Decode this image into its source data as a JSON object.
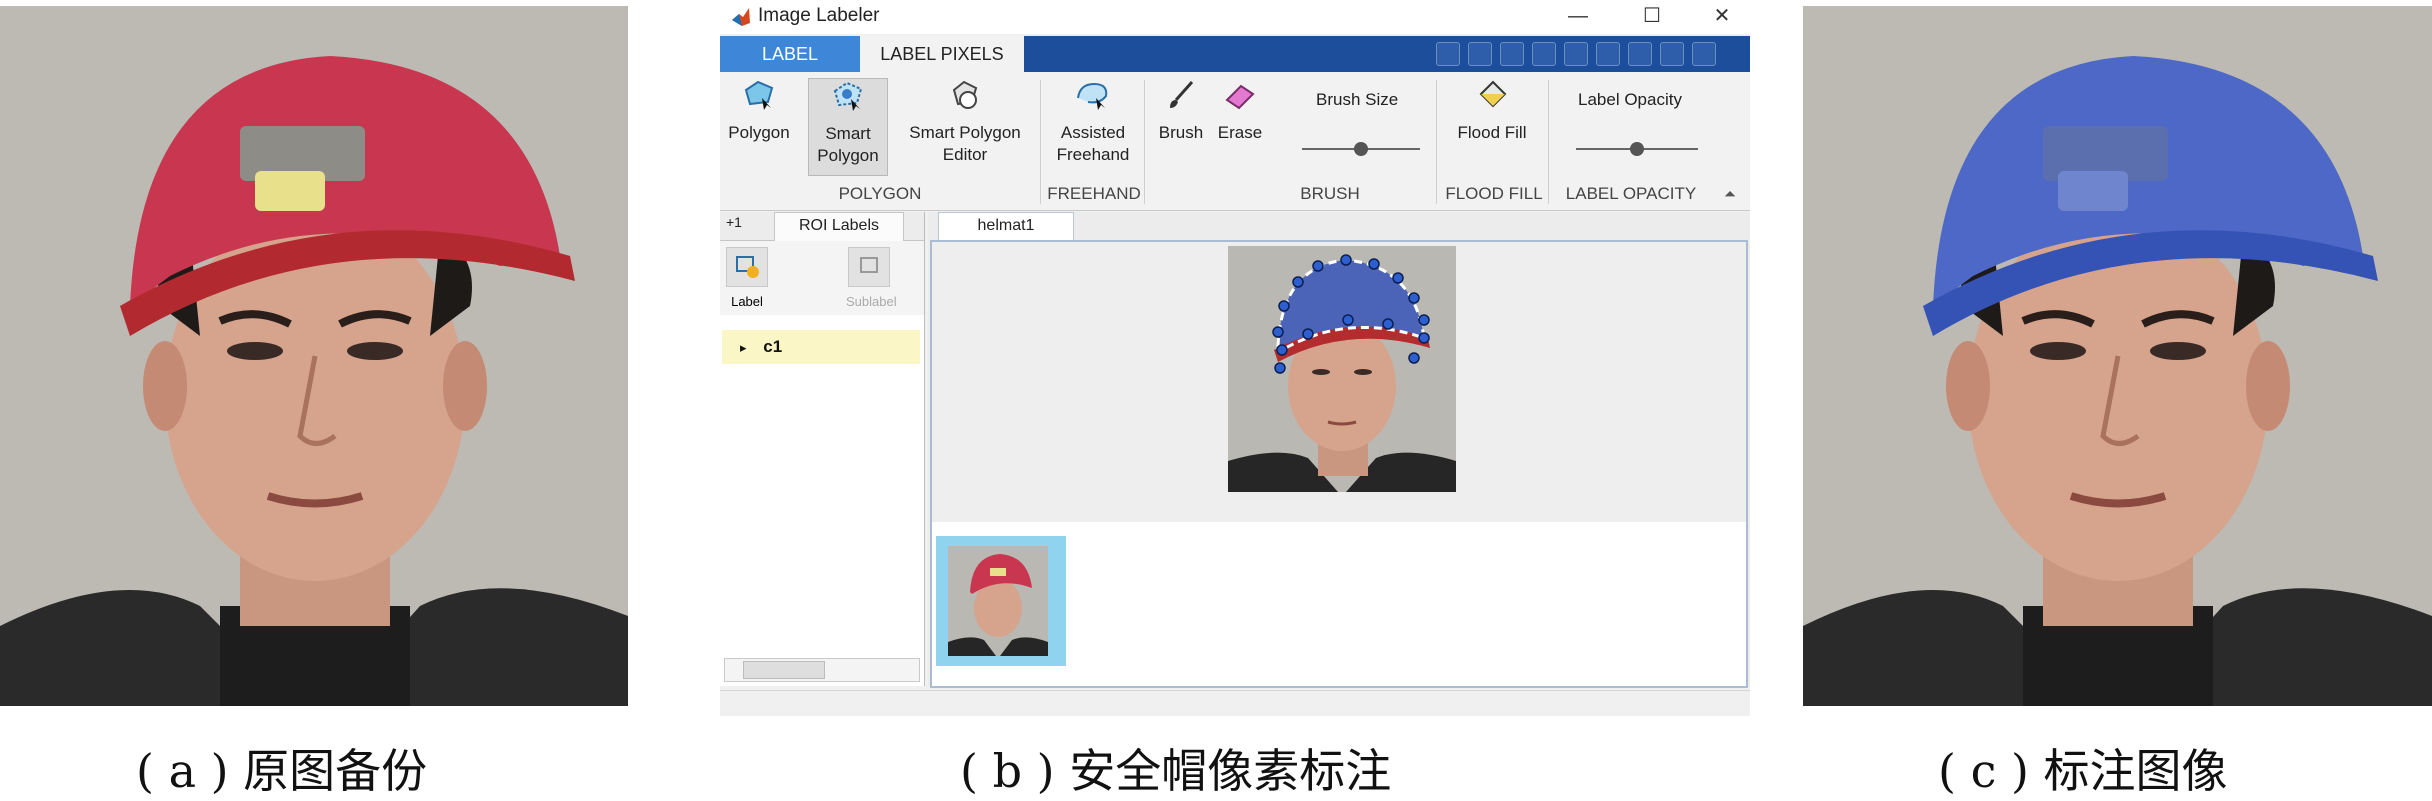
{
  "captions": {
    "a": "( a ) 原图备份",
    "b": "( b ) 安全帽像素标注",
    "c": "( c ) 标注图像"
  },
  "window": {
    "title": "Image Labeler",
    "controls": {
      "minimize": "—",
      "maximize": "☐",
      "close": "✕"
    },
    "tabs": [
      "LABEL",
      "LABEL PIXELS"
    ],
    "active_tab": "LABEL PIXELS",
    "accent_color": "#1c4e9c",
    "ribbon": {
      "buttons": {
        "polygon": "Polygon",
        "smart_polygon": [
          "Smart",
          "Polygon"
        ],
        "smart_polygon_editor": [
          "Smart Polygon",
          "Editor"
        ],
        "assisted_freehand": [
          "Assisted",
          "Freehand"
        ],
        "brush": "Brush",
        "erase": "Erase",
        "brush_size": "Brush Size",
        "flood_fill": "Flood Fill",
        "label_opacity": "Label Opacity"
      },
      "active_button": "Smart Polygon",
      "groups": [
        "POLYGON",
        "FREEHAND",
        "BRUSH",
        "FLOOD FILL",
        "LABEL OPACITY"
      ],
      "brush_size_level": 0.5,
      "label_opacity_level": 0.5
    },
    "left_panel": {
      "more": "+1",
      "tab": "ROI Labels",
      "tools": {
        "label": "Label",
        "sublabel": "Sublabel"
      },
      "items": [
        {
          "expander": "▸",
          "name": "c1",
          "color": "#fbf6c6"
        }
      ]
    },
    "document_tab": "helmat1",
    "helmet_label_color": "#3c63c8"
  }
}
